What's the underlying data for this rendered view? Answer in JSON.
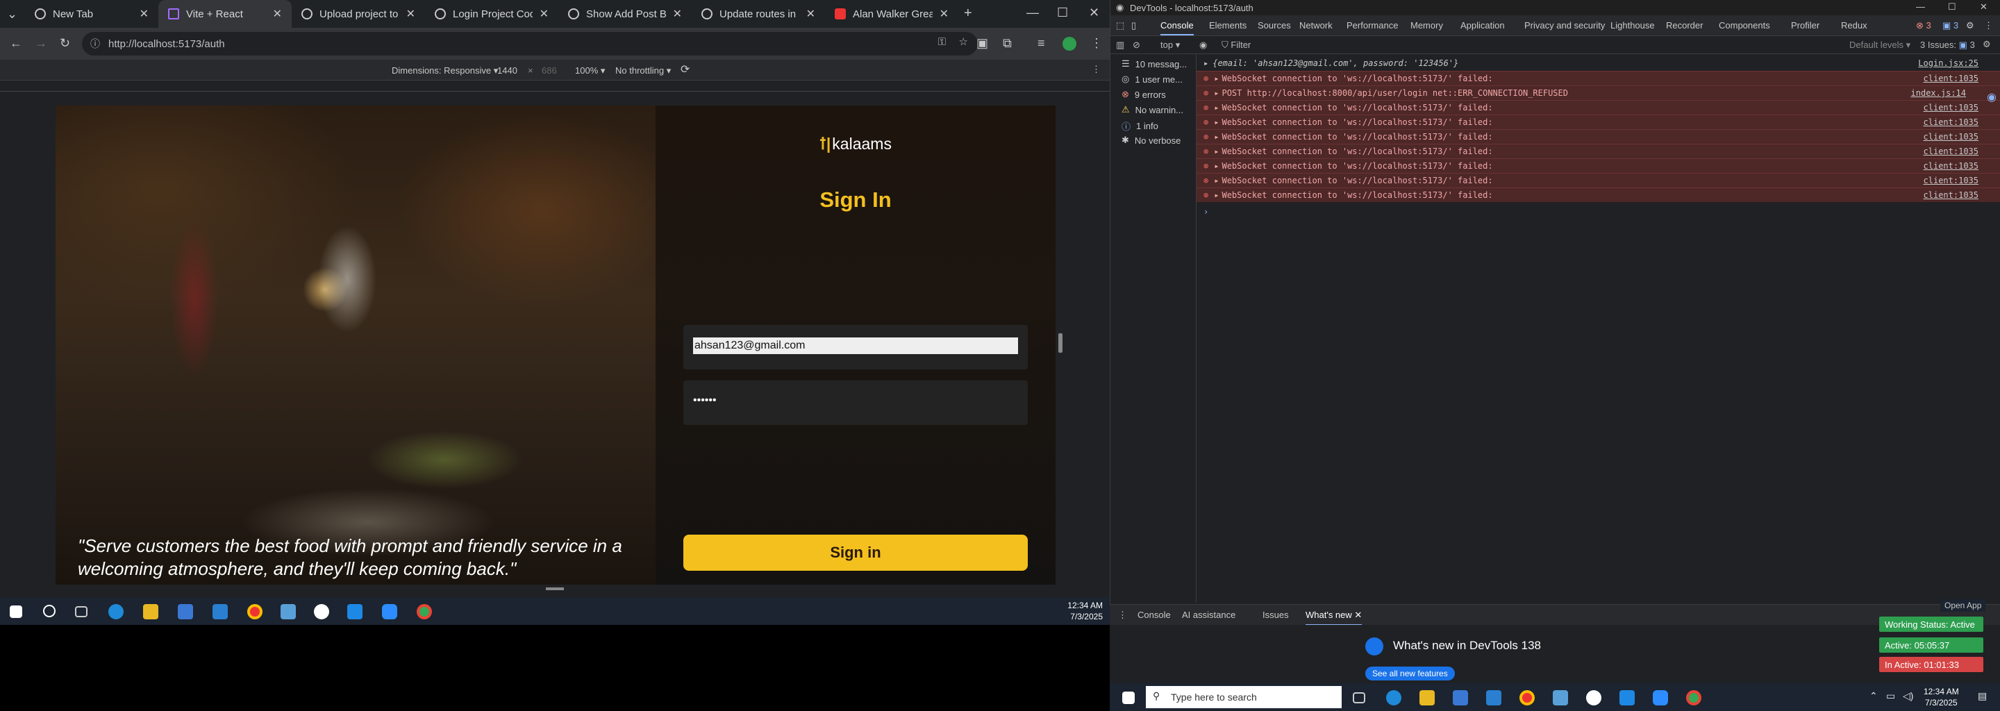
{
  "tabs": [
    {
      "label": "New Tab"
    },
    {
      "label": "Vite + React"
    },
    {
      "label": "Upload project to kala"
    },
    {
      "label": "Login Project Code He"
    },
    {
      "label": "Show Add Post Button"
    },
    {
      "label": "Update routes in app.j"
    },
    {
      "label": "Alan Walker Greate"
    }
  ],
  "address": {
    "url": "http://localhost:5173/auth"
  },
  "device_toolbar": {
    "dimensions": "Dimensions: Responsive",
    "width": "1440",
    "height": "686",
    "zoom": "100%",
    "throttle": "No throttling"
  },
  "page": {
    "brand": "kalaams",
    "title": "Sign In",
    "email_value": "ahsan123@gmail.com",
    "password_mask": "••••••",
    "button": "Sign in",
    "quote_line1": "\"Serve customers the best food with prompt and friendly service in a",
    "quote_line2": "welcoming atmosphere, and they'll keep coming back.\""
  },
  "taskbar_left": {
    "time": "12:34 AM",
    "date": "7/3/2025"
  },
  "devtools": {
    "window_title": "DevTools - localhost:5173/auth",
    "tabs": [
      "Console",
      "Elements",
      "Sources",
      "Network",
      "Performance",
      "Memory",
      "Application",
      "Privacy and security",
      "Lighthouse",
      "Recorder",
      "Components",
      "Profiler",
      "Redux"
    ],
    "errors_badge": "3",
    "issues_badge": "3",
    "context": "top",
    "filter_placeholder": "Filter",
    "levels": "Default levels",
    "issues_count": "3 Issues:",
    "sidebar": [
      {
        "label": "10 messag..."
      },
      {
        "label": "1 user me..."
      },
      {
        "label": "9 errors"
      },
      {
        "label": "No warnin..."
      },
      {
        "label": "1 info"
      },
      {
        "label": "No verbose"
      }
    ],
    "log": [
      {
        "text": "{email: 'ahsan123@gmail.com', password: '123456'}",
        "source": "Login.jsx:25",
        "error": false
      },
      {
        "text": "WebSocket connection to 'ws://localhost:5173/' failed:",
        "source": "client:1035",
        "error": true
      },
      {
        "text": "POST http://localhost:8000/api/user/login net::ERR_CONNECTION_REFUSED",
        "source": "index.js:14",
        "error": true
      },
      {
        "text": "WebSocket connection to 'ws://localhost:5173/' failed:",
        "source": "client:1035",
        "error": true
      },
      {
        "text": "WebSocket connection to 'ws://localhost:5173/' failed:",
        "source": "client:1035",
        "error": true
      },
      {
        "text": "WebSocket connection to 'ws://localhost:5173/' failed:",
        "source": "client:1035",
        "error": true
      },
      {
        "text": "WebSocket connection to 'ws://localhost:5173/' failed:",
        "source": "client:1035",
        "error": true
      },
      {
        "text": "WebSocket connection to 'ws://localhost:5173/' failed:",
        "source": "client:1035",
        "error": true
      },
      {
        "text": "WebSocket connection to 'ws://localhost:5173/' failed:",
        "source": "client:1035",
        "error": true
      },
      {
        "text": "WebSocket connection to 'ws://localhost:5173/' failed:",
        "source": "client:1035",
        "error": true
      }
    ],
    "drawer_tabs": [
      "Console",
      "AI assistance",
      "Issues",
      "What's new"
    ],
    "whats_new_title": "What's new in DevTools 138",
    "whats_new_link": "See all new features",
    "open_app": "Open App"
  },
  "status_badges": [
    {
      "label": "Working Status: Active",
      "color": "#2e9e4f"
    },
    {
      "label": "Active: 05:05:37",
      "color": "#2e9e4f"
    },
    {
      "label": "In Active: 01:01:33",
      "color": "#d64545"
    }
  ],
  "taskbar_right": {
    "search_placeholder": "Type here to search",
    "time": "12:34 AM",
    "date": "7/3/2025"
  },
  "colors": {
    "accent": "#f4c01e",
    "error_bg": "#4e2727"
  }
}
